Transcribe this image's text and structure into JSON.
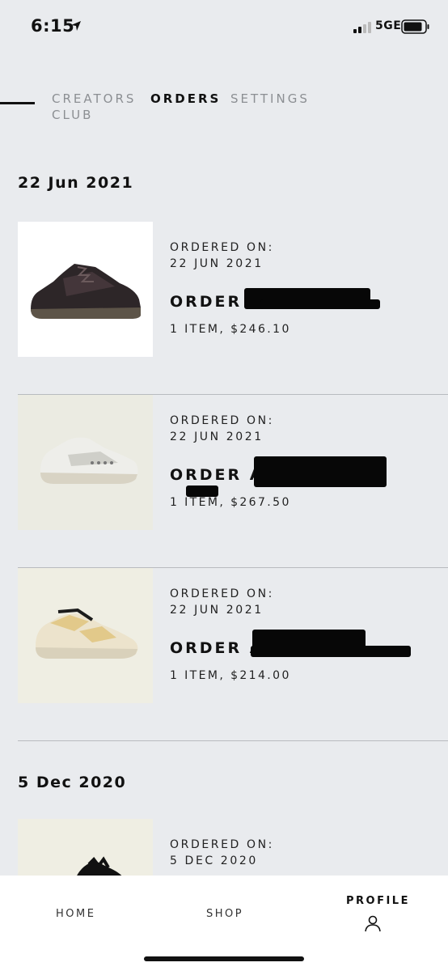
{
  "status_bar": {
    "time": "6:15",
    "network": "5GE"
  },
  "tabs": [
    {
      "label": "CREATORS CLUB",
      "active": false
    },
    {
      "label": "ORDERS",
      "active": true
    },
    {
      "label": "SETTINGS",
      "active": false
    }
  ],
  "sections": [
    {
      "date": "22 Jun 2021",
      "orders": [
        {
          "ordered_label": "ORDERED ON:",
          "ordered_date": "22 JUN 2021",
          "order_prefix": "ORDER A",
          "summary": "1 ITEM, $246.10",
          "product_icon": "dark-sneaker-icon"
        },
        {
          "ordered_label": "ORDERED ON:",
          "ordered_date": "22 JUN 2021",
          "order_prefix": "ORDER A",
          "summary": "1 ITEM, $267.50",
          "product_icon": "white-sneaker-icon"
        },
        {
          "ordered_label": "ORDERED ON:",
          "ordered_date": "22 JUN 2021",
          "order_prefix": "ORDER A",
          "summary": "1 ITEM, $214.00",
          "product_icon": "cream-sneaker-icon"
        }
      ]
    },
    {
      "date": "5 Dec 2020",
      "orders": [
        {
          "ordered_label": "ORDERED ON:",
          "ordered_date": "5 DEC 2020",
          "product_icon": "black-sneaker-icon"
        }
      ]
    }
  ],
  "bottom_nav": {
    "home": "HOME",
    "shop": "SHOP",
    "profile": "PROFILE"
  },
  "colors": {
    "background": "#e9ebee",
    "text": "#111111",
    "inactive_tab": "#8c8f93",
    "divider": "#b8bbbf",
    "nav_bg": "#ffffff"
  }
}
